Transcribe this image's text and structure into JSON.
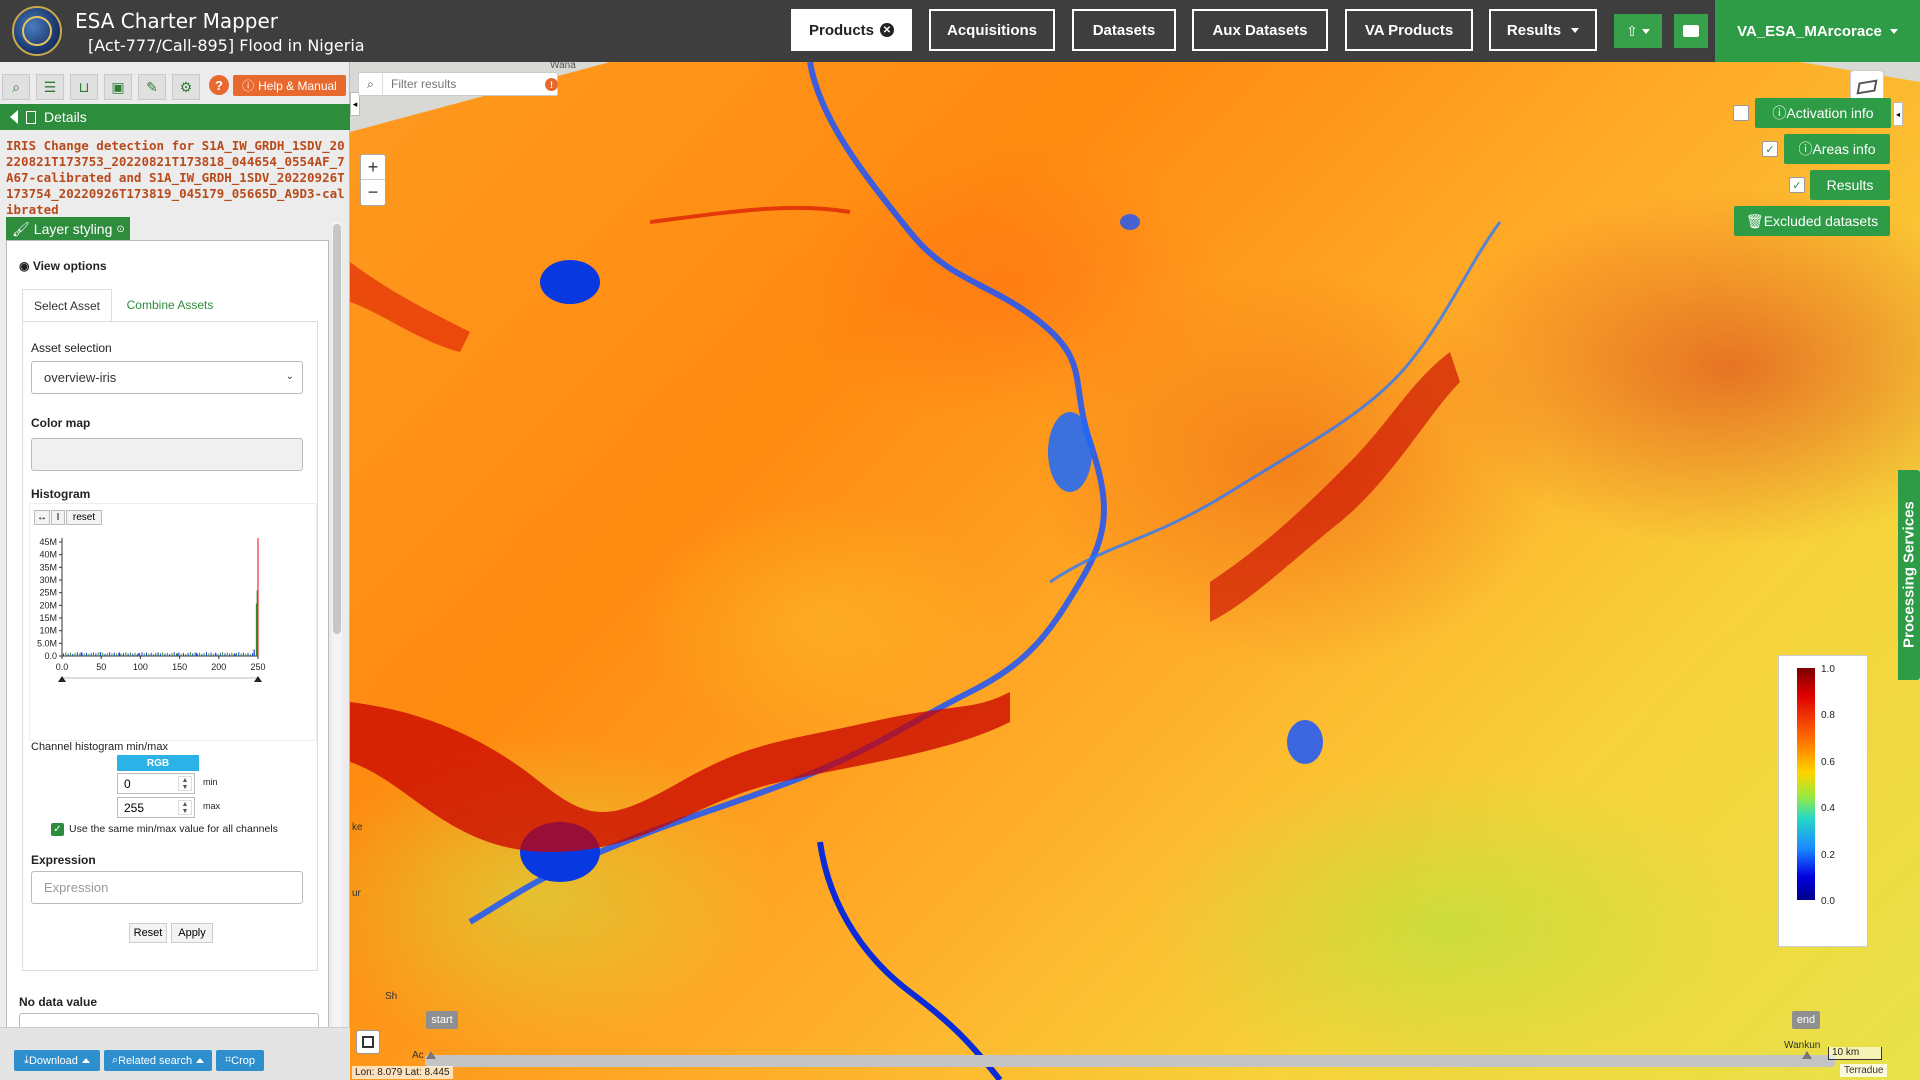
{
  "header": {
    "app_title": "ESA Charter Mapper",
    "app_subtitle": "[Act-777/Call-895] Flood in Nigeria",
    "nav": {
      "products": "Products",
      "acquisitions": "Acquisitions",
      "datasets": "Datasets",
      "aux_datasets": "Aux Datasets",
      "va_products": "VA Products",
      "results": "Results"
    },
    "user": "VA_ESA_MArcorace"
  },
  "toolbar": {
    "help": "Help & Manual"
  },
  "details": {
    "label": "Details",
    "title": "IRIS Change detection for S1A_IW_GRDH_1SDV_20220821T173753_20220821T173818_044654_0554AF_7A67-calibrated and S1A_IW_GRDH_1SDV_20220926T173754_20220926T173819_045179_05665D_A9D3-calibrated"
  },
  "styling": {
    "tab_label": "Layer styling",
    "view_options": "View options",
    "tabs": [
      "Select Asset",
      "Combine Assets"
    ],
    "asset_selection_label": "Asset selection",
    "asset_value": "overview-iris",
    "color_map_label": "Color map",
    "histogram_label": "Histogram",
    "hist_reset": "reset",
    "hist_yticks": [
      "45M",
      "40M",
      "35M",
      "30M",
      "25M",
      "20M",
      "15M",
      "10M",
      "5.0M",
      "0.0"
    ],
    "hist_xticks": [
      "0.0",
      "50",
      "100",
      "150",
      "200",
      "250"
    ],
    "channel_label": "Channel histogram min/max",
    "rgb": "RGB",
    "min_value": "0",
    "min_label": "min",
    "max_value": "255",
    "max_label": "max",
    "same_minmax": "Use the same min/max value for all channels",
    "expression_label": "Expression",
    "expression_placeholder": "Expression",
    "reset": "Reset",
    "apply": "Apply",
    "no_data_label": "No data value"
  },
  "bottom": {
    "download": "Download",
    "related": "Related search",
    "crop": "Crop"
  },
  "map": {
    "filter_placeholder": "Filter results",
    "activation_info": "Activation info",
    "areas_info": "Areas info",
    "results": "Results",
    "excluded": "Excluded datasets",
    "processing": "Processing Services",
    "legend_ticks": [
      "1.0",
      "0.8",
      "0.6",
      "0.4",
      "0.2",
      "0.0"
    ],
    "timeline_start": "start",
    "timeline_end": "end",
    "coords": "Lon: 8.079 Lat: 8.445",
    "scale": "10 km",
    "attribution": "Terradue",
    "place_labels": [
      "Wana",
      "Wankun",
      "Sh",
      "Ac",
      "ur",
      "ke"
    ]
  },
  "colors": {
    "brand_green": "#2e9b46",
    "accent_orange": "#e8692e",
    "header_bg": "#3e3e3e"
  },
  "chart_data": {
    "type": "bar",
    "title": "",
    "xlabel": "",
    "ylabel": "",
    "xlim": [
      0,
      255
    ],
    "ylim": [
      0,
      45000000
    ],
    "x": [
      0,
      25,
      50,
      75,
      100,
      125,
      150,
      175,
      200,
      225,
      250,
      253,
      254,
      255
    ],
    "series": [
      {
        "values": [
          0,
          1400000,
          1500000,
          1300000,
          1200000,
          1100000,
          1000000,
          1200000,
          1100000,
          1000000,
          2500000,
          20000000,
          25000000,
          48000000
        ]
      }
    ]
  }
}
